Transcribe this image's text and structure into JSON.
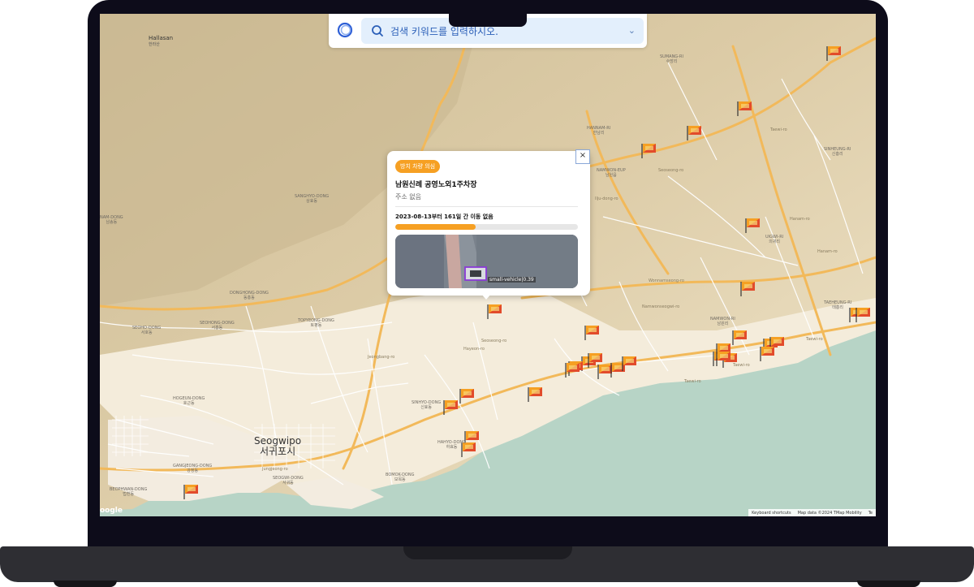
{
  "search": {
    "placeholder": "검색 키워드를 입력하시오."
  },
  "popup": {
    "badge": "방치 차량 의심",
    "title": "남원신례 공영노외1주차장",
    "address": "주소 없음",
    "stat": "2023-08-13부터 161일 간 이동 없음",
    "progress": 0.44,
    "detection_label": "small-vehicle|0.39",
    "close": "×"
  },
  "map": {
    "mountain": {
      "name": "Hallasan",
      "name_ko": "한라산"
    },
    "city": {
      "name": "Seogwipo",
      "name_ko": "서귀포시"
    },
    "places": [
      {
        "en": "SUMANG-RI",
        "ko": "수망리"
      },
      {
        "en": "HANNAM-RI",
        "ko": "한남리"
      },
      {
        "en": "NAMWON-EUP",
        "ko": "남원읍"
      },
      {
        "en": "SINHEUNG-RI",
        "ko": "신흥리"
      },
      {
        "en": "SANGHYO-DONG",
        "ko": "상효동"
      },
      {
        "en": "NAM-DONG",
        "ko": "남송동"
      },
      {
        "en": "UIGWI-RI",
        "ko": "의귀리"
      },
      {
        "en": "DONGHONG-DONG",
        "ko": "동홍동"
      },
      {
        "en": "TOPYEONG-DONG",
        "ko": "토평동"
      },
      {
        "en": "SEOHONG-DONG",
        "ko": "서홍동"
      },
      {
        "en": "SEOHO-DONG",
        "ko": "서호동"
      },
      {
        "en": "NAMWON-RI",
        "ko": "남원리"
      },
      {
        "en": "TAEHEUNG-RI",
        "ko": "태흥리"
      },
      {
        "en": "HOGEUN-DONG",
        "ko": "호근동"
      },
      {
        "en": "SINHYO-DONG",
        "ko": "신효동"
      },
      {
        "en": "HAHYO-DONG",
        "ko": "하효동"
      },
      {
        "en": "BOMOK-DONG",
        "ko": "보목동"
      },
      {
        "en": "SEOGWI-DONG",
        "ko": "서귀동"
      },
      {
        "en": "BEOPHWAN-DONG",
        "ko": "법환동"
      },
      {
        "en": "GANGJEONG-DONG",
        "ko": "강정동"
      }
    ],
    "roads": [
      "Namwonseogwi-ro",
      "Wonnamseong-ro",
      "Taewi-ro",
      "Taewi-ro",
      "Taewi-ro",
      "Hanam-ro",
      "Seoseong-ro",
      "Ilju-dong-ro",
      "Jungjeong-ro",
      "Hayeon-ro",
      "Taewi-ro",
      "Hanam-ro",
      "Seoseong-ro",
      "Jeongbang-ro"
    ],
    "attribution": [
      "Keyboard shortcuts",
      "Map data ©2024 TMap Mobility",
      "Te"
    ],
    "google": "oogle"
  },
  "colors": {
    "accent": "#f6a023",
    "search_bg": "#e3effc",
    "sea": "#b7d4c6",
    "land": "#eadcbc"
  }
}
